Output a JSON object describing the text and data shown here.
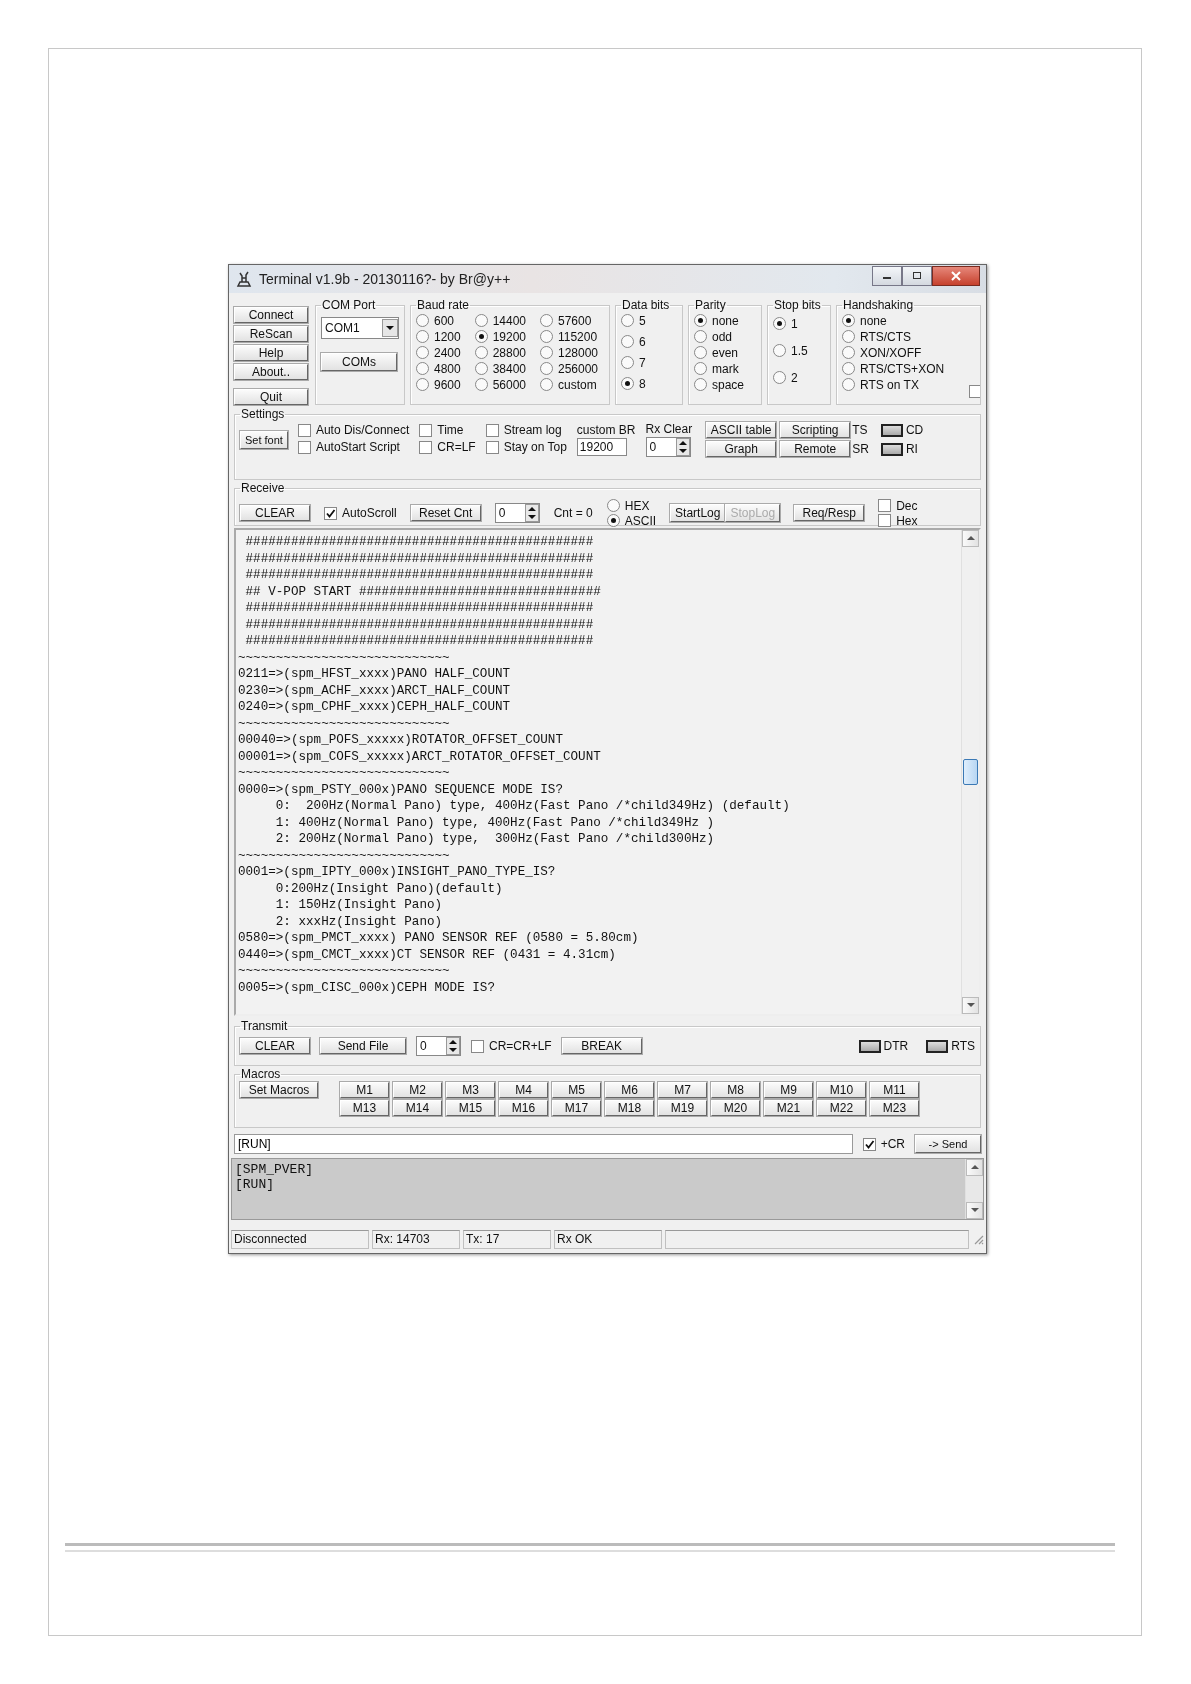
{
  "window": {
    "title": "Terminal v1.9b - 20130116?- by Br@y++"
  },
  "connection_buttons": [
    "Connect",
    "ReScan",
    "Help",
    "About..",
    "Quit"
  ],
  "com_port": {
    "label": "COM Port",
    "value": "COM1",
    "button": "COMs"
  },
  "baud_rate": {
    "label": "Baud rate",
    "options": [
      {
        "label": "600",
        "selected": false
      },
      {
        "label": "1200",
        "selected": false
      },
      {
        "label": "2400",
        "selected": false
      },
      {
        "label": "4800",
        "selected": false
      },
      {
        "label": "9600",
        "selected": false
      },
      {
        "label": "14400",
        "selected": false
      },
      {
        "label": "19200",
        "selected": true
      },
      {
        "label": "28800",
        "selected": false
      },
      {
        "label": "38400",
        "selected": false
      },
      {
        "label": "56000",
        "selected": false
      },
      {
        "label": "57600",
        "selected": false
      },
      {
        "label": "115200",
        "selected": false
      },
      {
        "label": "128000",
        "selected": false
      },
      {
        "label": "256000",
        "selected": false
      },
      {
        "label": "custom",
        "selected": false
      }
    ]
  },
  "data_bits": {
    "label": "Data bits",
    "options": [
      {
        "label": "5",
        "selected": false
      },
      {
        "label": "6",
        "selected": false
      },
      {
        "label": "7",
        "selected": false
      },
      {
        "label": "8",
        "selected": true
      }
    ]
  },
  "parity": {
    "label": "Parity",
    "options": [
      {
        "label": "none",
        "selected": true
      },
      {
        "label": "odd",
        "selected": false
      },
      {
        "label": "even",
        "selected": false
      },
      {
        "label": "mark",
        "selected": false
      },
      {
        "label": "space",
        "selected": false
      }
    ]
  },
  "stop_bits": {
    "label": "Stop bits",
    "options": [
      {
        "label": "1",
        "selected": true
      },
      {
        "label": "1.5",
        "selected": false
      },
      {
        "label": "2",
        "selected": false
      }
    ]
  },
  "handshaking": {
    "label": "Handshaking",
    "options": [
      {
        "label": "none",
        "selected": true
      },
      {
        "label": "RTS/CTS",
        "selected": false
      },
      {
        "label": "XON/XOFF",
        "selected": false
      },
      {
        "label": "RTS/CTS+XON",
        "selected": false
      },
      {
        "label": "RTS on TX",
        "selected": false
      }
    ],
    "extra_checkbox": {
      "checked": false
    }
  },
  "settings": {
    "label": "Settings",
    "set_font": "Set font",
    "checkboxes": [
      {
        "label": "Auto Dis/Connect",
        "checked": false
      },
      {
        "label": "AutoStart Script",
        "checked": false
      },
      {
        "label": "Time",
        "checked": false
      },
      {
        "label": "CR=LF",
        "checked": false
      },
      {
        "label": "Stream log",
        "checked": false
      },
      {
        "label": "Stay on Top",
        "checked": false
      }
    ],
    "custom_br": {
      "label": "custom BR",
      "value": "19200"
    },
    "rx_clear": {
      "label": "Rx Clear",
      "value": "0"
    },
    "buttons": [
      "ASCII table",
      "Scripting",
      "Graph",
      "Remote"
    ],
    "signals": [
      {
        "tag": "TS",
        "label": "CD"
      },
      {
        "tag": "SR",
        "label": "RI"
      }
    ]
  },
  "receive": {
    "label": "Receive",
    "clear": "CLEAR",
    "autoscroll": {
      "label": "AutoScroll",
      "checked": true
    },
    "reset": "Reset Cnt",
    "counter": "0",
    "count": "Cnt = 0",
    "format": [
      {
        "label": "HEX",
        "selected": false
      },
      {
        "label": "ASCII",
        "selected": true
      }
    ],
    "log_buttons": [
      {
        "label": "StartLog",
        "disabled": false
      },
      {
        "label": "StopLog",
        "disabled": true
      }
    ],
    "req_resp": "Req/Resp",
    "display": [
      {
        "label": "Dec",
        "checked": false
      },
      {
        "label": "Hex",
        "checked": false
      }
    ],
    "lines": [
      " ##############################################",
      " ##############################################",
      " ##############################################",
      " ## V-POP START ################################",
      " ##############################################",
      " ##############################################",
      " ##############################################",
      "~~~~~~~~~~~~~~~~~~~~~~~~~~~~",
      "0211=>(spm_HFST_xxxx)PANO HALF_COUNT",
      "0230=>(spm_ACHF_xxxx)ARCT_HALF_COUNT",
      "0240=>(spm_CPHF_xxxx)CEPH_HALF_COUNT",
      "~~~~~~~~~~~~~~~~~~~~~~~~~~~~",
      "00040=>(spm_POFS_xxxxx)ROTATOR_OFFSET_COUNT",
      "00001=>(spm_COFS_xxxxx)ARCT_ROTATOR_OFFSET_COUNT",
      "~~~~~~~~~~~~~~~~~~~~~~~~~~~~",
      "0000=>(spm_PSTY_000x)PANO SEQUENCE MODE IS?",
      "     0:  200Hz(Normal Pano) type, 400Hz(Fast Pano /*child349Hz) (default)",
      "     1: 400Hz(Normal Pano) type, 400Hz(Fast Pano /*child349Hz )",
      "     2: 200Hz(Normal Pano) type,  300Hz(Fast Pano /*child300Hz)",
      "~~~~~~~~~~~~~~~~~~~~~~~~~~~~",
      "0001=>(spm_IPTY_000x)INSIGHT_PANO_TYPE_IS?",
      "     0:200Hz(Insight Pano)(default)",
      "     1: 150Hz(Insight Pano)",
      "     2: xxxHz(Insight Pano)",
      "0580=>(spm_PMCT_xxxx) PANO SENSOR REF (0580 = 5.80cm)",
      "0440=>(spm_CMCT_xxxx)CT SENSOR REF (0431 = 4.31cm)",
      "~~~~~~~~~~~~~~~~~~~~~~~~~~~~",
      "0005=>(spm_CISC_000x)CEPH MODE IS?"
    ]
  },
  "transmit": {
    "label": "Transmit",
    "clear": "CLEAR",
    "send_file": "Send File",
    "counter": "0",
    "cr_option": {
      "label": "CR=CR+LF",
      "checked": false
    },
    "break": "BREAK",
    "signals": [
      "DTR",
      "RTS"
    ]
  },
  "macros": {
    "label": "Macros",
    "set": "Set Macros",
    "buttons": [
      "M1",
      "M2",
      "M3",
      "M4",
      "M5",
      "M6",
      "M7",
      "M8",
      "M9",
      "M10",
      "M11",
      "M13",
      "M14",
      "M15",
      "M16",
      "M17",
      "M18",
      "M19",
      "M20",
      "M21",
      "M22",
      "M23"
    ]
  },
  "send": {
    "value": "[RUN]",
    "append_cr": {
      "label": "+CR",
      "checked": true
    },
    "button": "-> Send"
  },
  "history": [
    "[SPM_PVER]",
    "[RUN]"
  ],
  "status_bar": [
    "Disconnected",
    "Rx: 14703",
    "Tx: 17",
    "Rx OK"
  ]
}
